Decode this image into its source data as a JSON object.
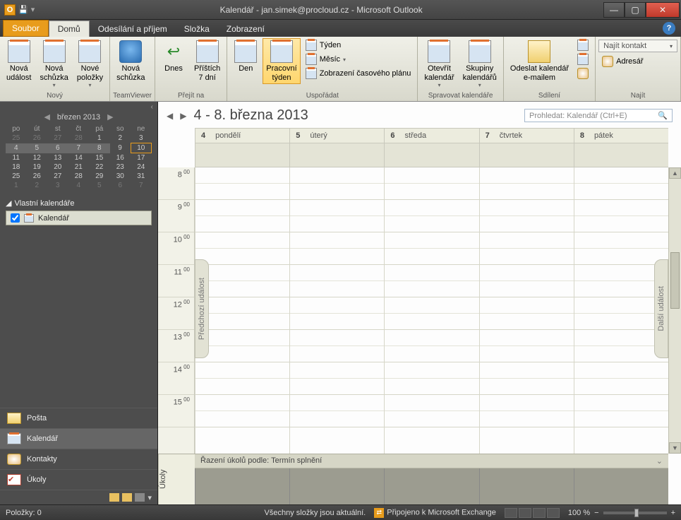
{
  "titlebar": {
    "title": "Kalendář - jan.simek@procloud.cz - Microsoft Outlook"
  },
  "tabs": {
    "file": "Soubor",
    "home": "Domů",
    "sendrecv": "Odesílání a příjem",
    "folder": "Složka",
    "view": "Zobrazení"
  },
  "ribbon": {
    "new": {
      "label": "Nový",
      "event": "Nová\nudálost",
      "meeting": "Nová\nschůzka",
      "items": "Nové\npoložky"
    },
    "tv": {
      "label": "TeamViewer",
      "meeting": "Nová\nschůzka"
    },
    "goto": {
      "label": "Přejít na",
      "today": "Dnes",
      "next7": "Příštích\n7 dní"
    },
    "arrange": {
      "label": "Uspořádat",
      "day": "Den",
      "workweek": "Pracovní\ntýden",
      "week": "Týden",
      "month": "Měsíc",
      "schedule": "Zobrazení časového plánu"
    },
    "manage": {
      "label": "Spravovat kalendáře",
      "open": "Otevřít\nkalendář",
      "groups": "Skupiny\nkalendářů"
    },
    "share": {
      "label": "Sdílení",
      "email": "Odeslat kalendář\ne-mailem"
    },
    "find": {
      "label": "Najít",
      "contact": "Najít kontakt",
      "addressbook": "Adresář"
    }
  },
  "minical": {
    "month": "březen 2013",
    "dow": [
      "po",
      "út",
      "st",
      "čt",
      "pá",
      "so",
      "ne"
    ],
    "rows": [
      [
        "25",
        "26",
        "27",
        "28",
        "1",
        "2",
        "3"
      ],
      [
        "4",
        "5",
        "6",
        "7",
        "8",
        "9",
        "10"
      ],
      [
        "11",
        "12",
        "13",
        "14",
        "15",
        "16",
        "17"
      ],
      [
        "18",
        "19",
        "20",
        "21",
        "22",
        "23",
        "24"
      ],
      [
        "25",
        "26",
        "27",
        "28",
        "29",
        "30",
        "31"
      ],
      [
        "1",
        "2",
        "3",
        "4",
        "5",
        "6",
        "7"
      ]
    ]
  },
  "nav": {
    "ownCalsHead": "Vlastní kalendáře",
    "calItem": "Kalendář",
    "mail": "Pošta",
    "calendar": "Kalendář",
    "contacts": "Kontakty",
    "tasks": "Úkoly"
  },
  "calview": {
    "title": "4 - 8. března 2013",
    "searchPlaceholder": "Prohledat: Kalendář (Ctrl+E)",
    "days": [
      {
        "n": "4",
        "name": "pondělí"
      },
      {
        "n": "5",
        "name": "úterý"
      },
      {
        "n": "6",
        "name": "středa"
      },
      {
        "n": "7",
        "name": "čtvrtek"
      },
      {
        "n": "8",
        "name": "pátek"
      }
    ],
    "hours": [
      "8",
      "9",
      "10",
      "11",
      "12",
      "13",
      "14",
      "15"
    ],
    "prevLabel": "Předchozí událost",
    "nextLabel": "Další událost"
  },
  "tasks": {
    "label": "Úkoly",
    "sortHead": "Řazení úkolů podle: Termín splnění"
  },
  "status": {
    "items": "Položky: 0",
    "sync": "Všechny složky jsou aktuální.",
    "conn": "Připojeno k Microsoft Exchange",
    "zoom": "100 %"
  }
}
